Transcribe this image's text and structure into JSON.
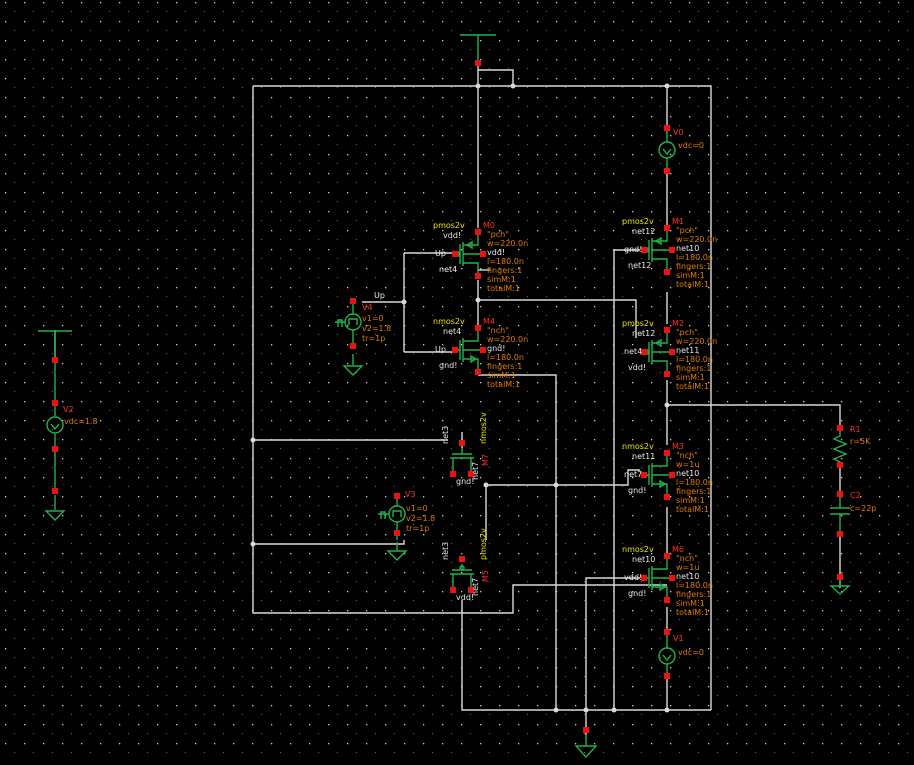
{
  "schematic": {
    "background": "#000000",
    "colors": {
      "wire": "#d9d9d9",
      "symbol": "#22b14c",
      "pin": "#ee1111",
      "param": "#e07b00",
      "cell": "#e6e600",
      "instance": "#ff3030",
      "net": "#e8e8e8"
    },
    "net_labels": {
      "up": "Up"
    },
    "transistors": [
      {
        "inst": "M0",
        "cell": "pmos2v",
        "model": "\"pch\"",
        "w": "w=220.0n",
        "l": "l=180.0n",
        "fingers": "fingers:1",
        "simM": "simM:1",
        "totalM": "totalM:1",
        "nets": [
          "vdd!",
          "Up",
          "net4",
          "vdd!"
        ]
      },
      {
        "inst": "M1",
        "cell": "pmos2v",
        "model": "\"pch\"",
        "w": "w=220.0n",
        "l": "l=180.0n",
        "fingers": "fingers:1",
        "simM": "simM:1",
        "totalM": "totalM:1",
        "nets": [
          "net12",
          "gnd!",
          "net12",
          "net10"
        ]
      },
      {
        "inst": "M4",
        "cell": "nmos2v",
        "model": "\"nch\"",
        "w": "w=220.0n",
        "l": "l=180.0n",
        "fingers": "fingers:1",
        "simM": "simM:1",
        "totalM": "totalM:1",
        "nets": [
          "net4",
          "Up",
          "gnd!",
          "gnd!"
        ]
      },
      {
        "inst": "M2",
        "cell": "pmos2v",
        "model": "\"pch\"",
        "w": "w=220.0n",
        "l": "l=180.0n",
        "fingers": "fingers:1",
        "simM": "simM:1",
        "totalM": "totalM:1",
        "nets": [
          "net12",
          "net4",
          "vdd!",
          "net11"
        ]
      },
      {
        "inst": "M3",
        "cell": "nmos2v",
        "model": "\"nch\"",
        "w": "w=1u",
        "l": "l=180.0n",
        "fingers": "fingers:1",
        "simM": "simM:1",
        "totalM": "totalM:1",
        "nets": [
          "net11",
          "net7",
          "gnd!",
          "net10"
        ]
      },
      {
        "inst": "M6",
        "cell": "nmos2v",
        "model": "\"nch\"",
        "w": "w=1u",
        "l": "l=180.0n",
        "fingers": "fingers:1",
        "simM": "simM:1",
        "totalM": "totalM:1",
        "nets": [
          "net10",
          "vdd!",
          "gnd!",
          "net10"
        ]
      },
      {
        "inst": "M7",
        "cell": "nmos2v",
        "model": "\"nch\"",
        "nets": [
          "net3",
          "net7",
          "gnd!"
        ]
      },
      {
        "inst": "M5",
        "cell": "pmos2v",
        "model": "\"pch\"",
        "nets": [
          "net3",
          "net7",
          "vdd!"
        ]
      }
    ],
    "sources": [
      {
        "inst": "V4",
        "params": [
          "v1=0",
          "v2=1.8",
          "tr=1p"
        ]
      },
      {
        "inst": "V3",
        "params": [
          "v1=0",
          "v2=1.8",
          "tr=1p"
        ]
      },
      {
        "inst": "V2",
        "params": [
          "vdc=1.8"
        ]
      },
      {
        "inst": "V0",
        "params": [
          "vdc=0"
        ]
      },
      {
        "inst": "V1",
        "params": [
          "vdc=0"
        ]
      }
    ],
    "passives": [
      {
        "inst": "R1",
        "param": "r=5K"
      },
      {
        "inst": "C2",
        "param": "c=22p"
      }
    ]
  }
}
